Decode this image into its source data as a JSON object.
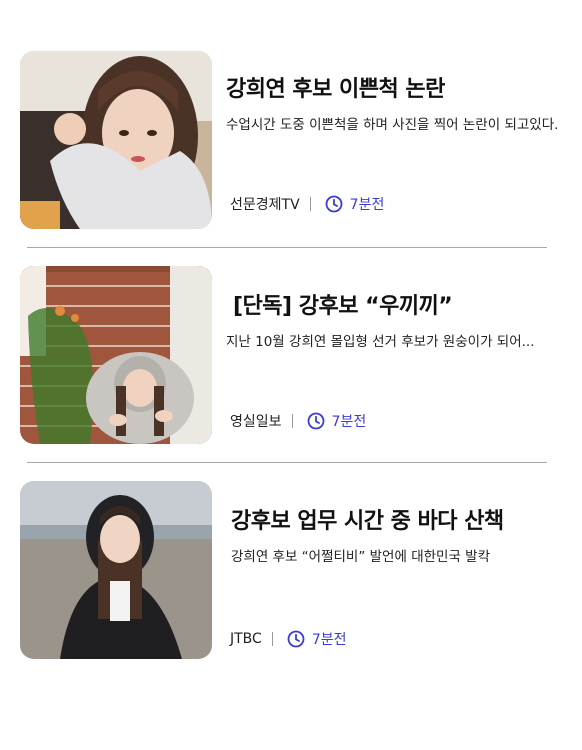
{
  "articles": [
    {
      "headline": "강희연 후보 이쁜척 논란",
      "summary": "수업시간 도중 이쁜척을 하며 사진을 찍어 논란이 되고있다.",
      "source": "선문경제TV",
      "time": "7분전",
      "thumbnail": "girl-selfie-photo"
    },
    {
      "headline": "[단독] 강후보 “우끼끼”",
      "summary": "지난 10월 강희연 몰입형 선거 후보가 원숭이가 되어...",
      "source": "영실일보",
      "time": "7분전",
      "thumbnail": "girl-by-brick-wall-photo"
    },
    {
      "headline": "강후보 업무 시간 중 바다 산책",
      "summary": "강희연 후보 “어쩔티비” 발언에 대한민국 발칵",
      "source": "JTBC",
      "time": "7분전",
      "thumbnail": "girl-at-beach-photo"
    }
  ],
  "colors": {
    "time_accent": "#3b3bd6",
    "divider": "#a9a9a9"
  },
  "icons": {
    "time": "clock-icon"
  }
}
